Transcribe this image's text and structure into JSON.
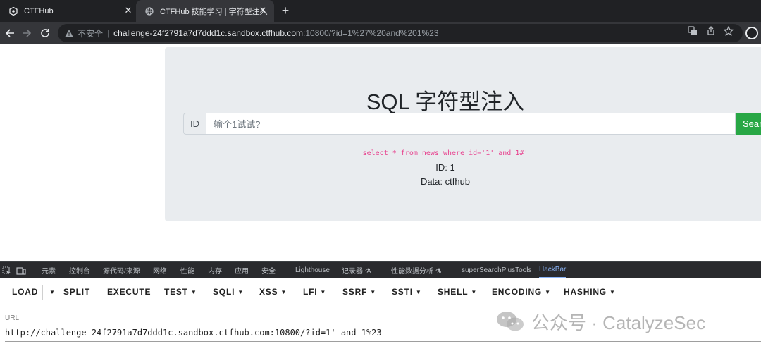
{
  "browser": {
    "tabs": [
      {
        "title": "CTFHub",
        "favicon": "ctfhub-logo-icon"
      },
      {
        "title": "CTFHub 技能学习 | 字符型注入",
        "favicon": "globe-icon"
      }
    ],
    "new_tab": "+",
    "address": {
      "insecure_label": "不安全",
      "separator": "|",
      "host": "challenge-24f2791a7d7ddd1c.sandbox.ctfhub.com",
      "rest": ":10800/?id=1%27%20and%201%23"
    }
  },
  "page": {
    "heading": "SQL 字符型注入",
    "input_prefix": "ID",
    "input_placeholder": "输个1试试?",
    "search_label": "Search",
    "sql": "select * from news where id='1' and 1#'",
    "result_id": "ID: 1",
    "result_data": "Data: ctfhub"
  },
  "devtools": {
    "tabs": [
      "元素",
      "控制台",
      "源代码/来源",
      "网络",
      "性能",
      "内存",
      "应用",
      "安全",
      "Lighthouse",
      "记录器 ⚗",
      "性能数据分析 ⚗",
      "superSearchPlusTools",
      "HackBar"
    ],
    "active_tab": "HackBar"
  },
  "hackbar": {
    "menu": [
      "LOAD",
      "SPLIT",
      "EXECUTE",
      "TEST",
      "SQLI",
      "XSS",
      "LFI",
      "SSRF",
      "SSTI",
      "SHELL",
      "ENCODING",
      "HASHING"
    ],
    "url_label": "URL",
    "url_value": "http://challenge-24f2791a7d7ddd1c.sandbox.ctfhub.com:10800/?id=1' and 1%23"
  },
  "watermark": {
    "text": "公众号 · CatalyzeSec"
  },
  "colors": {
    "chrome_dark": "#202124",
    "toolbar": "#35363a",
    "jumbotron": "#e9ecef",
    "search_button": "#28a745",
    "sql_code": "#e83e8c",
    "devtools_active": "#8ab4f8"
  }
}
